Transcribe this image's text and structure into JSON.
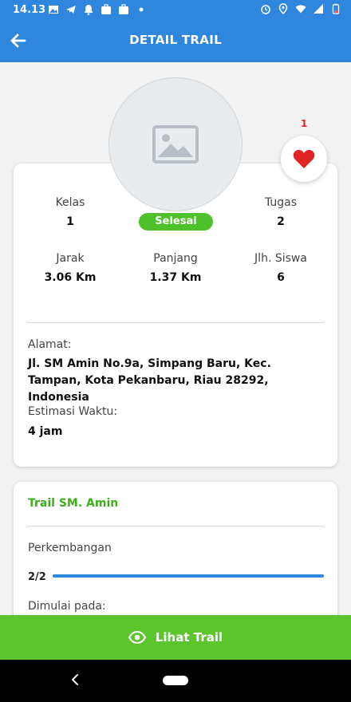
{
  "status_bar": {
    "time": "14.13",
    "icons_left": [
      "gallery-icon",
      "telegram-icon",
      "notification-bell-icon",
      "briefcase-icon",
      "briefcase-icon",
      "dot-icon"
    ],
    "icons_right": [
      "alarm-icon",
      "location-icon",
      "wifi-icon",
      "signal-icon",
      "battery-icon"
    ]
  },
  "app_bar": {
    "title": "DETAIL TRAIL",
    "back_icon": "arrow-left-icon"
  },
  "like": {
    "count": "1",
    "icon": "heart-icon"
  },
  "stats": {
    "kelas": {
      "label": "Kelas",
      "value": "1"
    },
    "tugas": {
      "label": "Tugas",
      "value": "2"
    },
    "status": "Selesai",
    "jarak": {
      "label": "Jarak",
      "value": "3.06 Km"
    },
    "panjang": {
      "label": "Panjang",
      "value": "1.37 Km"
    },
    "jlh_siswa": {
      "label": "Jlh. Siswa",
      "value": "6"
    }
  },
  "address": {
    "label": "Alamat:",
    "value": "Jl. SM Amin No.9a, Simpang Baru, Kec. Tampan, Kota Pekanbaru, Riau 28292, Indonesia"
  },
  "estimate": {
    "label": "Estimasi Waktu:",
    "value": "4 jam"
  },
  "trail": {
    "name": "Trail SM. Amin",
    "progress_label": "Perkembangan",
    "progress_text": "2/2",
    "progress_fraction": 1.0,
    "started_label": "Dimulai pada:"
  },
  "cta": {
    "label": "Lihat Trail",
    "icon": "eye-icon"
  },
  "colors": {
    "primary": "#2f86dd",
    "accent_green": "#5cc52e",
    "heart_red": "#e02424"
  }
}
